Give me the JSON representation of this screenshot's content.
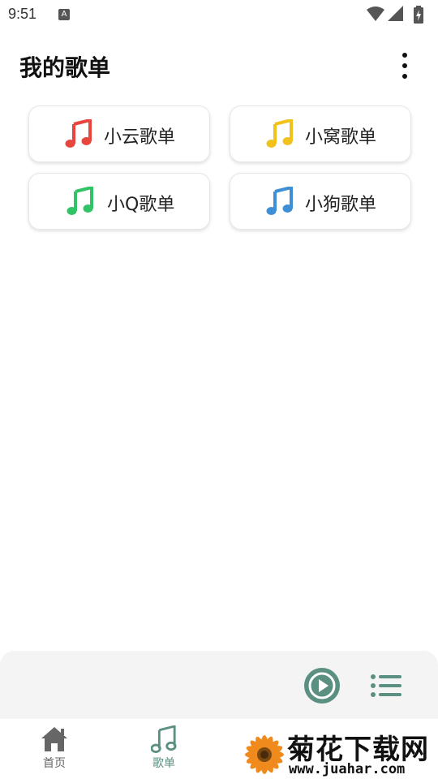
{
  "status_bar": {
    "time": "9:51",
    "notification_icon_letter": "A",
    "icons": [
      "wifi-icon",
      "signal-icon",
      "battery-icon"
    ]
  },
  "header": {
    "title": "我的歌单",
    "menu_icon": "more-vertical-icon"
  },
  "playlists": [
    {
      "label": "小云歌单",
      "icon": "music-note-icon",
      "color": "#e8453c"
    },
    {
      "label": "小窝歌单",
      "icon": "music-note-icon",
      "color": "#f1c21b"
    },
    {
      "label": "小Q歌单",
      "icon": "music-note-icon",
      "color": "#31c466"
    },
    {
      "label": "小狗歌单",
      "icon": "music-note-icon",
      "color": "#3d8fd6"
    }
  ],
  "player": {
    "play_icon": "play-circle-icon",
    "playlist_icon": "playlist-icon",
    "accent": "#5a8f82"
  },
  "bottom_nav": {
    "items": [
      {
        "label": "首页",
        "icon": "home-icon",
        "active": false,
        "color": "#666666"
      },
      {
        "label": "歌单",
        "icon": "music-note-icon",
        "active": true,
        "color": "#5a8f82"
      }
    ]
  },
  "watermark": {
    "title": "菊花下载网",
    "url": "www.juahar.com"
  }
}
